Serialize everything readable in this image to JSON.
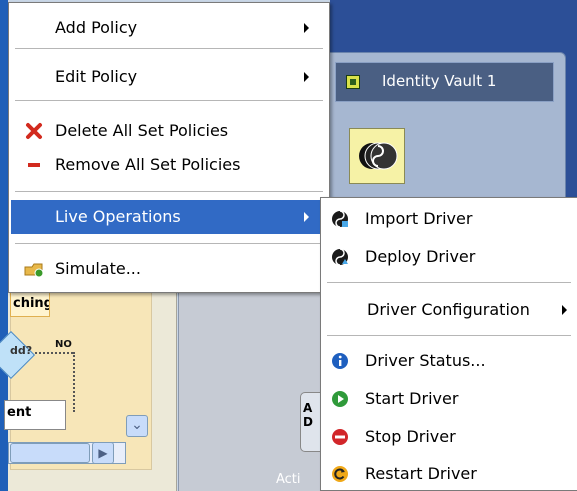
{
  "colors": {
    "highlight": "#316ac5",
    "desktop_blue": "#2c4f97",
    "vault_title_bg": "#4a5f83"
  },
  "background": {
    "vault_title": "Identity Vault 1",
    "flow_label": "ching",
    "decision_text": "dd?",
    "no_label": "NO",
    "entity_label": "ent",
    "widget_text": "A D",
    "bottom_text": "Acti"
  },
  "context_menu": {
    "items": [
      {
        "label": "Add Policy",
        "has_submenu": true
      },
      {
        "label": "Edit Policy",
        "has_submenu": true
      },
      {
        "label": "Delete All Set Policies",
        "icon": "red-x-icon"
      },
      {
        "label": "Remove All Set Policies",
        "icon": "red-minus-icon"
      },
      {
        "label": "Live Operations",
        "has_submenu": true,
        "highlighted": true
      },
      {
        "label": "Simulate...",
        "icon": "simulate-icon"
      }
    ]
  },
  "live_operations_menu": {
    "items": [
      {
        "label": "Import Driver",
        "icon": "import-driver-icon"
      },
      {
        "label": "Deploy Driver",
        "icon": "deploy-driver-icon"
      },
      {
        "label": "Driver Configuration",
        "has_submenu": true
      },
      {
        "label": "Driver Status...",
        "icon": "info-icon"
      },
      {
        "label": "Start Driver",
        "icon": "start-icon"
      },
      {
        "label": "Stop Driver",
        "icon": "stop-icon"
      },
      {
        "label": "Restart Driver",
        "icon": "restart-icon"
      }
    ]
  }
}
